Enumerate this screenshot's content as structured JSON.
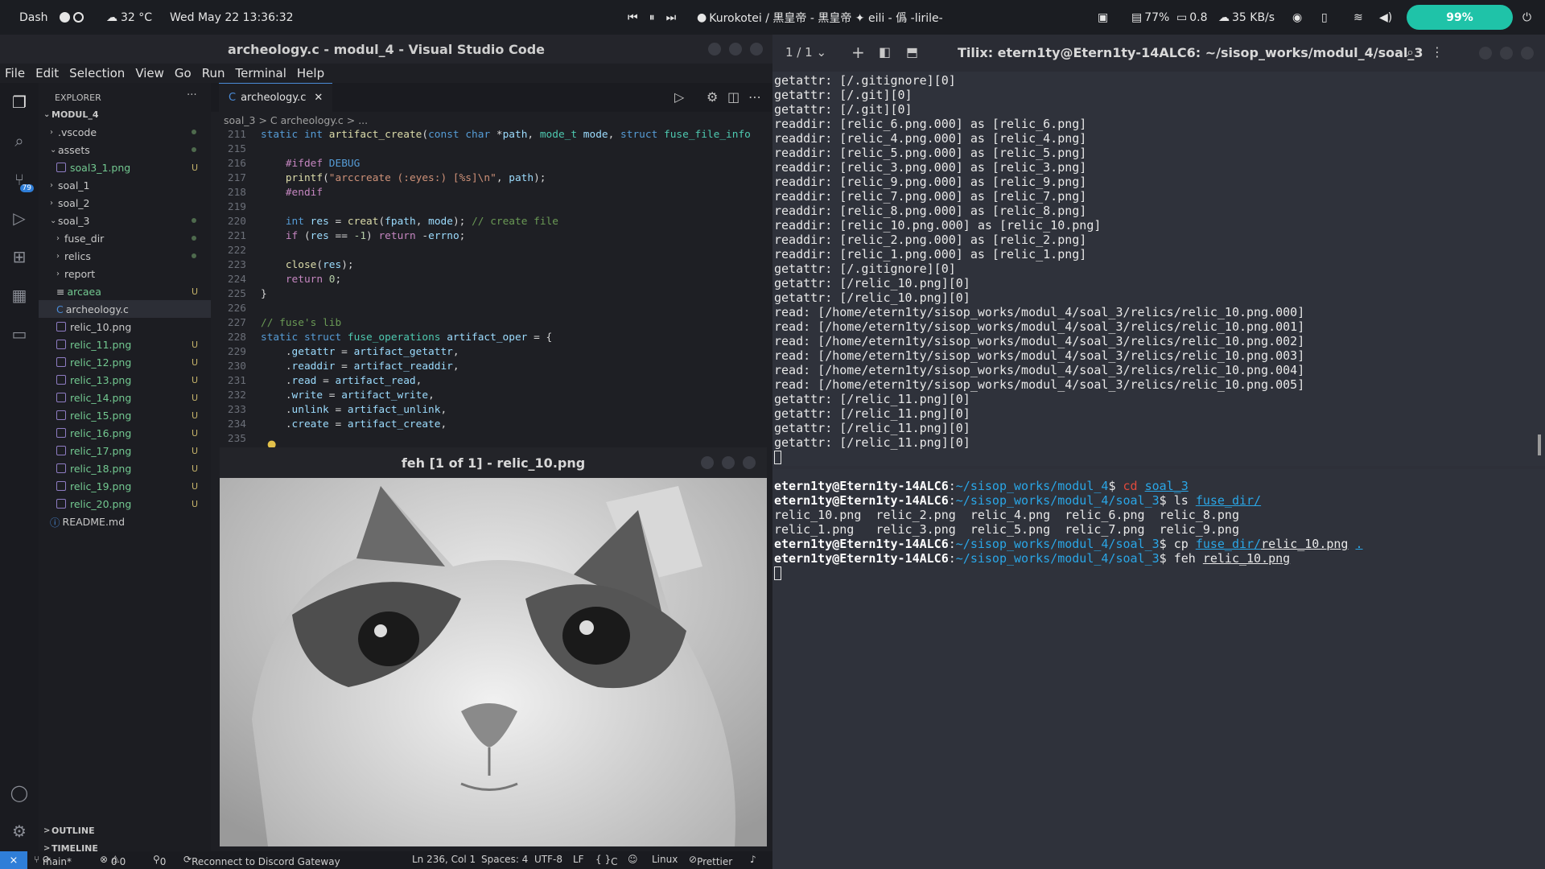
{
  "topbar": {
    "dash": "Dash",
    "weather": "32 °C",
    "datetime": "Wed May 22  13:36:32",
    "media": "Kurokotei / 黒皇帝 - 黒皇帝 ✦ eili - 僞 -lirile-",
    "cpu": "77%",
    "load": "0.8",
    "net": "35 KB/s",
    "battery": "99%"
  },
  "vscode": {
    "title": "archeology.c - modul_4 - Visual Studio Code",
    "menu": [
      "File",
      "Edit",
      "Selection",
      "View",
      "Go",
      "Run",
      "Terminal",
      "Help"
    ],
    "explorer_label": "EXPLORER",
    "tree": [
      {
        "label": "MODUL_4",
        "indent": 0,
        "arrow": "v",
        "type": "root"
      },
      {
        "label": ".vscode",
        "indent": 1,
        "arrow": ">",
        "badge": "dot"
      },
      {
        "label": "assets",
        "indent": 1,
        "arrow": "v",
        "badge": "dot"
      },
      {
        "label": "soal3_1.png",
        "indent": 2,
        "file": "img",
        "badge": "U"
      },
      {
        "label": "soal_1",
        "indent": 1,
        "arrow": ">"
      },
      {
        "label": "soal_2",
        "indent": 1,
        "arrow": ">"
      },
      {
        "label": "soal_3",
        "indent": 1,
        "arrow": "v",
        "badge": "dot"
      },
      {
        "label": "fuse_dir",
        "indent": 2,
        "arrow": ">",
        "badge": "dot"
      },
      {
        "label": "relics",
        "indent": 2,
        "arrow": ">",
        "badge": "dot"
      },
      {
        "label": "report",
        "indent": 2,
        "arrow": ">"
      },
      {
        "label": "arcaea",
        "indent": 2,
        "file": "txt",
        "badge": "U"
      },
      {
        "label": "archeology.c",
        "indent": 2,
        "file": "c",
        "selected": true
      },
      {
        "label": "relic_10.png",
        "indent": 2,
        "file": "img"
      },
      {
        "label": "relic_11.png",
        "indent": 2,
        "file": "img",
        "badge": "U"
      },
      {
        "label": "relic_12.png",
        "indent": 2,
        "file": "img",
        "badge": "U"
      },
      {
        "label": "relic_13.png",
        "indent": 2,
        "file": "img",
        "badge": "U"
      },
      {
        "label": "relic_14.png",
        "indent": 2,
        "file": "img",
        "badge": "U"
      },
      {
        "label": "relic_15.png",
        "indent": 2,
        "file": "img",
        "badge": "U"
      },
      {
        "label": "relic_16.png",
        "indent": 2,
        "file": "img",
        "badge": "U"
      },
      {
        "label": "relic_17.png",
        "indent": 2,
        "file": "img",
        "badge": "U"
      },
      {
        "label": "relic_18.png",
        "indent": 2,
        "file": "img",
        "badge": "U"
      },
      {
        "label": "relic_19.png",
        "indent": 2,
        "file": "img",
        "badge": "U"
      },
      {
        "label": "relic_20.png",
        "indent": 2,
        "file": "img",
        "badge": "U"
      },
      {
        "label": "README.md",
        "indent": 1,
        "file": "info"
      }
    ],
    "outline": "OUTLINE",
    "timeline": "TIMELINE",
    "tab": "archeology.c",
    "breadcrumb": "soal_3 > C archeology.c > ...",
    "source_badge": "79",
    "code": [
      {
        "n": "211",
        "html": "<span class='kw'>static</span> <span class='kw'>int</span> <span class='fn'>artifact_create</span>(<span class='kw'>const</span> <span class='kw'>char</span> *<span class='pr'>path</span>, <span class='ty'>mode_t</span> <span class='pr'>mode</span>, <span class='kw'>struct</span> <span class='ty'>fuse_file_info</span>"
      },
      {
        "n": "215",
        "html": ""
      },
      {
        "n": "216",
        "html": "    <span class='pp'>#ifdef</span> <span class='kw'>DEBUG</span>"
      },
      {
        "n": "217",
        "html": "    <span class='fn'>printf</span>(<span class='st'>\"arccreate (:eyes:) [%s]\\n\"</span>, <span class='pr'>path</span>);"
      },
      {
        "n": "218",
        "html": "    <span class='pp'>#endif</span>"
      },
      {
        "n": "219",
        "html": ""
      },
      {
        "n": "220",
        "html": "    <span class='kw'>int</span> <span class='pr'>res</span> = <span class='fn'>creat</span>(<span class='pr'>fpath</span>, <span class='pr'>mode</span>); <span class='cm'>// create file</span>"
      },
      {
        "n": "221",
        "html": "    <span class='pp'>if</span> (<span class='pr'>res</span> == <span class='nm'>-1</span>) <span class='pp'>return</span> -<span class='pr'>errno</span>;"
      },
      {
        "n": "222",
        "html": ""
      },
      {
        "n": "223",
        "html": "    <span class='fn'>close</span>(<span class='pr'>res</span>);"
      },
      {
        "n": "224",
        "html": "    <span class='pp'>return</span> <span class='nm'>0</span>;"
      },
      {
        "n": "225",
        "html": "}"
      },
      {
        "n": "226",
        "html": ""
      },
      {
        "n": "227",
        "html": "<span class='cm'>// fuse's lib</span>"
      },
      {
        "n": "228",
        "html": "<span class='kw'>static</span> <span class='kw'>struct</span> <span class='ty'>fuse_operations</span> <span class='pr'>artifact_oper</span> = {"
      },
      {
        "n": "229",
        "html": "    .<span class='pr'>getattr</span> = <span class='pr'>artifact_getattr</span>,"
      },
      {
        "n": "230",
        "html": "    .<span class='pr'>readdir</span> = <span class='pr'>artifact_readdir</span>,"
      },
      {
        "n": "231",
        "html": "    .<span class='pr'>read</span> = <span class='pr'>artifact_read</span>,"
      },
      {
        "n": "232",
        "html": "    .<span class='pr'>write</span> = <span class='pr'>artifact_write</span>,"
      },
      {
        "n": "233",
        "html": "    .<span class='pr'>unlink</span> = <span class='pr'>artifact_unlink</span>,"
      },
      {
        "n": "234",
        "html": "    .<span class='pr'>create</span> = <span class='pr'>artifact_create</span>,"
      },
      {
        "n": "235",
        "html": ""
      }
    ],
    "status": {
      "branch": "main*",
      "errors": "0",
      "warnings": "0",
      "ports": "0",
      "discord": "Reconnect to Discord Gateway",
      "pos": "Ln 236, Col 1",
      "spaces": "Spaces: 4",
      "enc": "UTF-8",
      "eol": "LF",
      "lang": "C",
      "os": "Linux",
      "prettier": "Prettier"
    }
  },
  "feh": {
    "title": "feh [1 of 1] - relic_10.png"
  },
  "terminal": {
    "tabs": "1 / 1",
    "title": "Tilix: etern1ty@Etern1ty-14ALC6: ~/sisop_works/modul_4/soal_3",
    "pane1": [
      "getattr: [/.gitignore][0]",
      "getattr: [/.git][0]",
      "getattr: [/.git][0]",
      "readdir: [relic_6.png.000] as [relic_6.png]",
      "readdir: [relic_4.png.000] as [relic_4.png]",
      "readdir: [relic_5.png.000] as [relic_5.png]",
      "readdir: [relic_3.png.000] as [relic_3.png]",
      "readdir: [relic_9.png.000] as [relic_9.png]",
      "readdir: [relic_7.png.000] as [relic_7.png]",
      "readdir: [relic_8.png.000] as [relic_8.png]",
      "readdir: [relic_10.png.000] as [relic_10.png]",
      "readdir: [relic_2.png.000] as [relic_2.png]",
      "readdir: [relic_1.png.000] as [relic_1.png]",
      "getattr: [/.gitignore][0]",
      "getattr: [/relic_10.png][0]",
      "getattr: [/relic_10.png][0]",
      "read: [/home/etern1ty/sisop_works/modul_4/soal_3/relics/relic_10.png.000]",
      "read: [/home/etern1ty/sisop_works/modul_4/soal_3/relics/relic_10.png.001]",
      "read: [/home/etern1ty/sisop_works/modul_4/soal_3/relics/relic_10.png.002]",
      "read: [/home/etern1ty/sisop_works/modul_4/soal_3/relics/relic_10.png.003]",
      "read: [/home/etern1ty/sisop_works/modul_4/soal_3/relics/relic_10.png.004]",
      "read: [/home/etern1ty/sisop_works/modul_4/soal_3/relics/relic_10.png.005]",
      "getattr: [/relic_11.png][0]",
      "getattr: [/relic_11.png][0]",
      "getattr: [/relic_11.png][0]",
      "getattr: [/relic_11.png][0]"
    ],
    "pane2": [
      "<span class='grn'>etern1ty@Etern1ty-14ALC6</span>:<span class='blu'>~/sisop_works/modul_4</span>$ <span class='red'>cd</span> <span class='blu und'>soal_3</span>",
      "<span class='grn'>etern1ty@Etern1ty-14ALC6</span>:<span class='blu'>~/sisop_works/modul_4/soal_3</span>$ ls <span class='blu und'>fuse_dir/</span>",
      "relic_10.png  relic_2.png  relic_4.png  relic_6.png  relic_8.png",
      "relic_1.png   relic_3.png  relic_5.png  relic_7.png  relic_9.png",
      "<span class='grn'>etern1ty@Etern1ty-14ALC6</span>:<span class='blu'>~/sisop_works/modul_4/soal_3</span>$ cp <span class='blu und'>fuse_dir/</span><span class='und'>relic_10.png</span> <span class='blu und'>.</span>",
      "<span class='grn'>etern1ty@Etern1ty-14ALC6</span>:<span class='blu'>~/sisop_works/modul_4/soal_3</span>$ feh <span class='und'>relic_10.png</span>"
    ]
  }
}
